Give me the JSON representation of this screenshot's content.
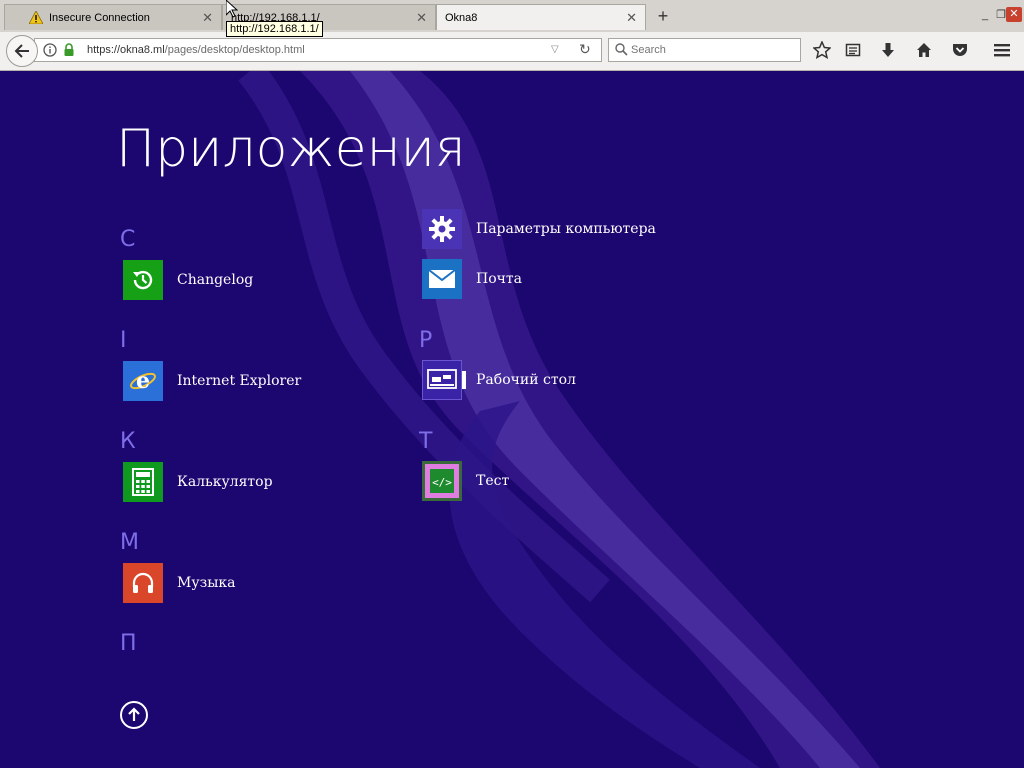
{
  "browser": {
    "tabs": [
      {
        "title": "Insecure Connection",
        "state": "inactive",
        "warning": true
      },
      {
        "title": "http://192.168.1.1/",
        "state": "inactive",
        "warning": false
      },
      {
        "title": "Okna8",
        "state": "active",
        "warning": false
      }
    ],
    "tooltip": "http://192.168.1.1/",
    "url_host": "https://okna8.ml",
    "url_path": "/pages/desktop/desktop.html",
    "search_placeholder": "Search",
    "toolbar_icons": [
      "star-icon",
      "reading-list-icon",
      "download-icon",
      "home-icon",
      "pocket-icon",
      "menu-icon"
    ]
  },
  "page": {
    "title": "Приложения",
    "groups": [
      {
        "letter": "C",
        "apps": [
          {
            "label": "Changelog",
            "icon": "changelog-icon",
            "color": "#15a015"
          }
        ]
      },
      {
        "letter": "I",
        "apps": [
          {
            "label": "Internet Explorer",
            "icon": "ie-icon",
            "color": "#2b6fd8"
          }
        ]
      },
      {
        "letter": "К",
        "apps": [
          {
            "label": "Калькулятор",
            "icon": "calculator-icon",
            "color": "#0f9a1f"
          }
        ]
      },
      {
        "letter": "М",
        "apps": [
          {
            "label": "Музыка",
            "icon": "headphones-icon",
            "color": "#d9462a"
          }
        ]
      },
      {
        "letter": "П",
        "apps": [
          {
            "label": "Параметры компьютера",
            "icon": "gear-icon",
            "color": "#4a33b4"
          },
          {
            "label": "Почта",
            "icon": "mail-icon",
            "color": "#1b72c4"
          }
        ]
      },
      {
        "letter": "Р",
        "apps": [
          {
            "label": "Рабочий стол",
            "icon": "desktop-icon",
            "color": "#3b23a8"
          }
        ]
      },
      {
        "letter": "Т",
        "apps": [
          {
            "label": "Тест",
            "icon": "code-icon",
            "color": "#e07de0"
          }
        ]
      }
    ]
  }
}
